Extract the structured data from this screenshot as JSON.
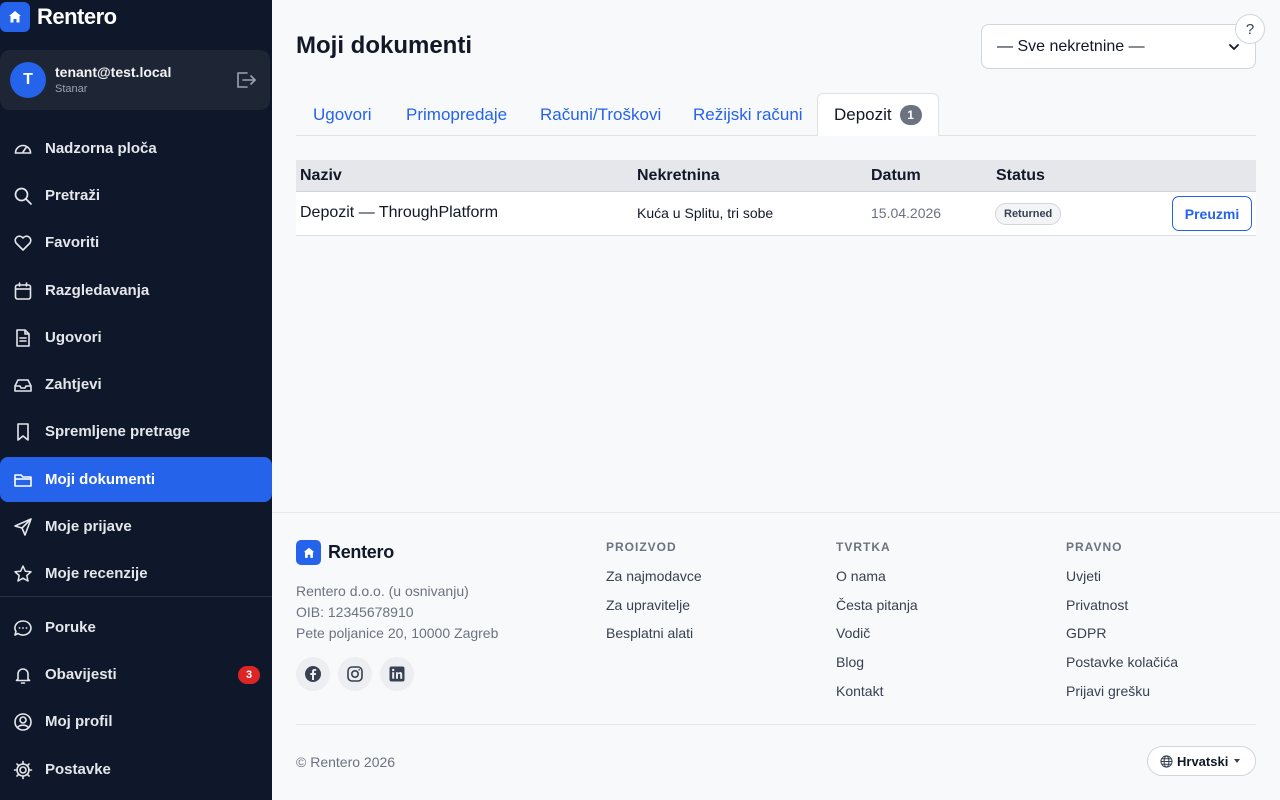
{
  "brand": {
    "name": "Rentero"
  },
  "user": {
    "initial": "T",
    "email": "tenant@test.local",
    "role": "Stanar"
  },
  "sidebar": {
    "items": [
      {
        "label": "Nadzorna ploča",
        "icon": "dashboard-gauge-icon"
      },
      {
        "label": "Pretraži",
        "icon": "search-icon"
      },
      {
        "label": "Favoriti",
        "icon": "heart-icon"
      },
      {
        "label": "Razgledavanja",
        "icon": "calendar-icon"
      },
      {
        "label": "Ugovori",
        "icon": "document-icon"
      },
      {
        "label": "Zahtjevi",
        "icon": "inbox-icon"
      },
      {
        "label": "Spremljene pretrage",
        "icon": "bookmark-icon"
      },
      {
        "label": "Moji dokumenti",
        "icon": "folder-icon",
        "active": true
      },
      {
        "label": "Moje prijave",
        "icon": "send-icon"
      },
      {
        "label": "Moje recenzije",
        "icon": "star-icon"
      },
      {
        "label": "Poruke",
        "icon": "chat-icon"
      },
      {
        "label": "Obavijesti",
        "icon": "bell-icon",
        "badge": "3"
      },
      {
        "label": "Moj profil",
        "icon": "user-circle-icon"
      },
      {
        "label": "Postavke",
        "icon": "gear-icon"
      }
    ]
  },
  "main": {
    "title": "Moji dokumenti",
    "property_filter": "— Sve nekretnine —",
    "help": "?",
    "tabs": [
      {
        "label": "Ugovori"
      },
      {
        "label": "Primopredaje"
      },
      {
        "label": "Računi/Troškovi"
      },
      {
        "label": "Režijski računi"
      },
      {
        "label": "Depozit",
        "badge": "1",
        "active": true
      }
    ],
    "table": {
      "headers": [
        "Naziv",
        "Nekretnina",
        "Datum",
        "Status"
      ],
      "rows": [
        {
          "name": "Depozit — ThroughPlatform",
          "property": "Kuća u Splitu, tri sobe",
          "date": "15.04.2026",
          "status": "Returned",
          "action": "Preuzmi"
        }
      ]
    }
  },
  "footer": {
    "brand": "Rentero",
    "company_lines": [
      "Rentero d.o.o. (u osnivanju)",
      "OIB: 12345678910",
      "Pete poljanice 20, 10000 Zagreb"
    ],
    "social": [
      "facebook-icon",
      "instagram-icon",
      "linkedin-icon"
    ],
    "columns": [
      {
        "heading": "PROIZVOD",
        "links": [
          "Za najmodavce",
          "Za upravitelje",
          "Besplatni alati"
        ]
      },
      {
        "heading": "TVRTKA",
        "links": [
          "O nama",
          "Česta pitanja",
          "Vodič",
          "Blog",
          "Kontakt"
        ]
      },
      {
        "heading": "PRAVNO",
        "links": [
          "Uvjeti",
          "Privatnost",
          "GDPR",
          "Postavke kolačića",
          "Prijavi grešku"
        ]
      }
    ],
    "copyright": "© Rentero 2026",
    "language": "Hrvatski"
  },
  "colors": {
    "sidebar_bg": "#0f172a",
    "accent": "#2563eb",
    "badge_red": "#dc2626"
  }
}
